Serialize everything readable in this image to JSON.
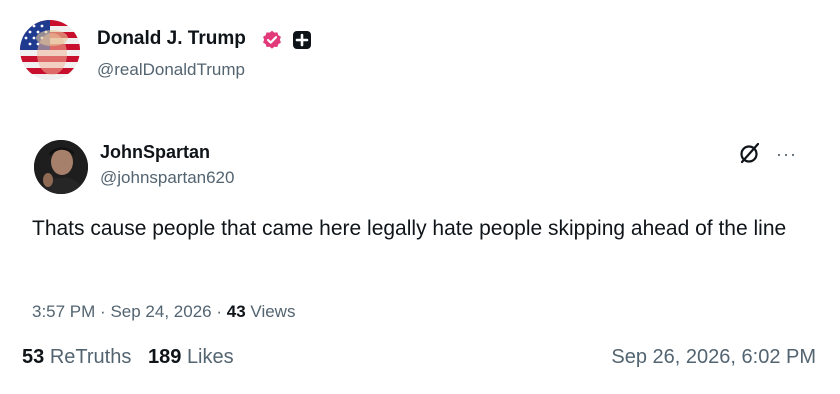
{
  "author": {
    "name": "Donald J. Trump",
    "handle": "@realDonaldTrump",
    "verified_color": "#e2397a",
    "badge_icon": "plus-square-icon"
  },
  "reply": {
    "name": "JohnSpartan",
    "handle": "@johnspartan620",
    "text": "Thats cause people that came here legally hate people skipping ahead of the line",
    "time": "3:57 PM",
    "date": "Sep 24, 2026",
    "views_count": "43",
    "views_label": "Views",
    "more_label": "···"
  },
  "stats": {
    "retruths_count": "53",
    "retruths_label": "ReTruths",
    "likes_count": "189",
    "likes_label": "Likes",
    "posted_at": "Sep 26, 2026, 6:02 PM"
  },
  "separator": "·"
}
